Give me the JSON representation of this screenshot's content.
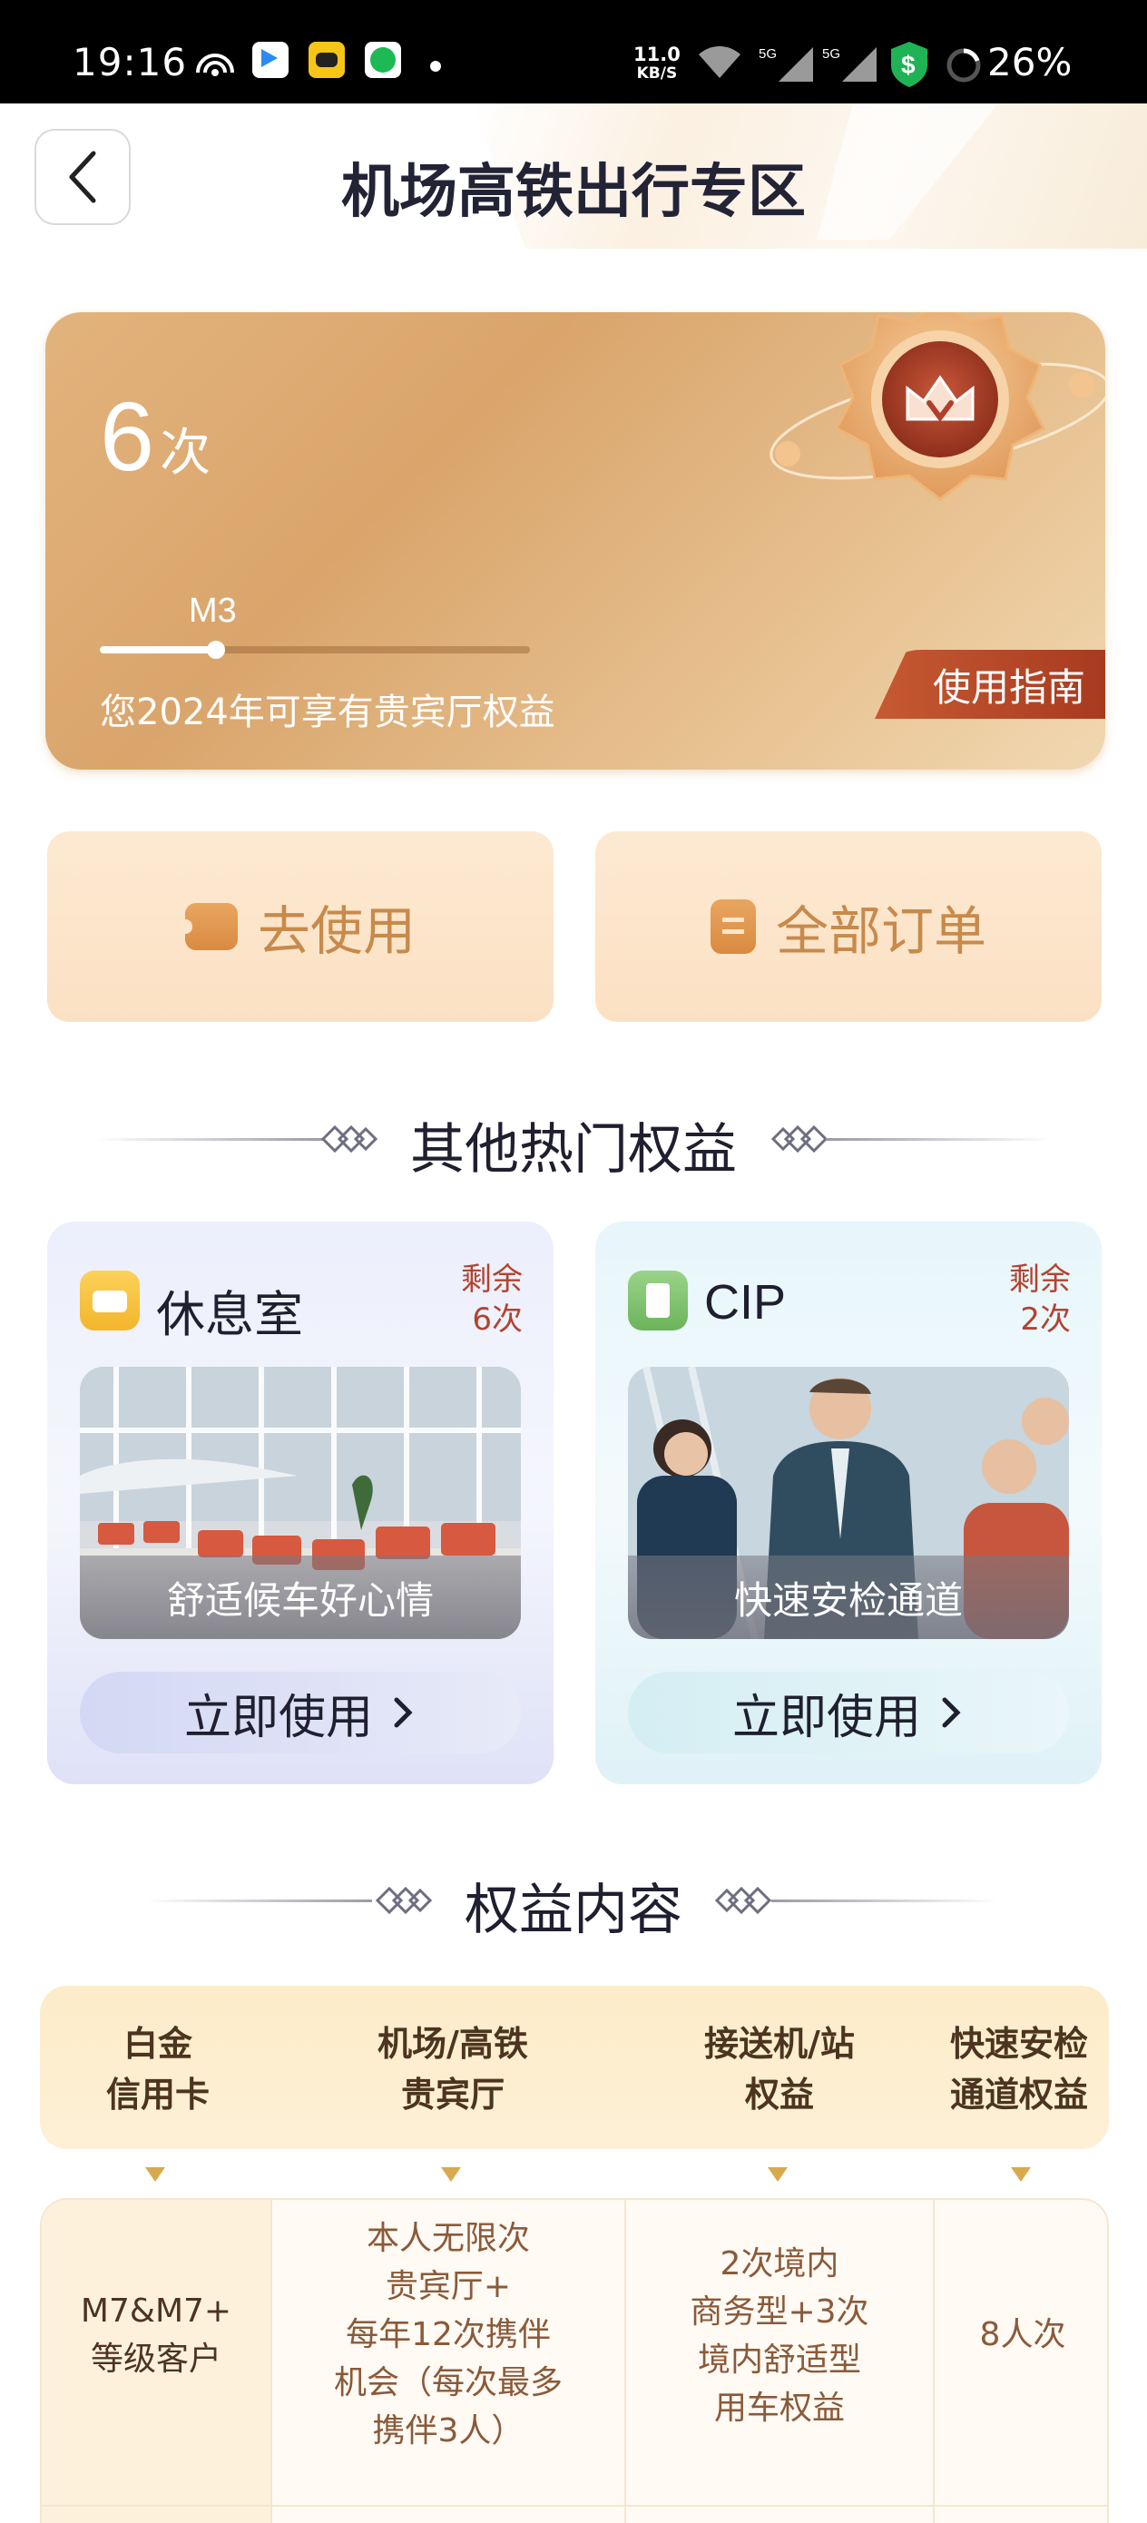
{
  "status_bar": {
    "time": "19:16",
    "net_speed_value": "11.0",
    "net_speed_unit": "KB/S",
    "signal_1": "5G",
    "signal_2": "5G",
    "battery": "26%"
  },
  "header": {
    "title": "机场高铁出行专区"
  },
  "summary_card": {
    "count": "6",
    "count_unit": "次",
    "level": "M3",
    "progress": 0.27,
    "description": "您2024年可享有贵宾厅权益",
    "guide_label": "使用指南"
  },
  "actions": {
    "use_label": "去使用",
    "orders_label": "全部订单"
  },
  "sections": {
    "hot_benefits": "其他热门权益",
    "benefit_content": "权益内容"
  },
  "benefits": [
    {
      "name": "休息室",
      "remain_label": "剩余",
      "remain_count": "6次",
      "caption": "舒适候车好心情",
      "use_label": "立即使用"
    },
    {
      "name": "CIP",
      "remain_label": "剩余",
      "remain_count": "2次",
      "caption": "快速安检通道",
      "use_label": "立即使用"
    }
  ],
  "table": {
    "headers": [
      [
        "白金",
        "信用卡"
      ],
      [
        "机场/高铁",
        "贵宾厅"
      ],
      [
        "接送机/站",
        "权益"
      ],
      [
        "快速安检",
        "通道权益"
      ]
    ],
    "rows": [
      {
        "tier": [
          "M7&M7+",
          "等级客户"
        ],
        "lounge": [
          "本人无限次",
          "贵宾厅+",
          "每年12次携伴",
          "机会（每次最多",
          "携伴3人）"
        ],
        "transfer": [
          "2次境内",
          "商务型+3次",
          "境内舒适型",
          "用车权益"
        ],
        "security": [
          "8人次"
        ]
      }
    ]
  },
  "colors": {
    "gold_card": "#d9a56c",
    "action_bg": "#fbe1c3",
    "action_text": "#c78a4b",
    "remain_text": "#b2432f",
    "guide_btn": "#a83a1f",
    "table_head": "#fdecc9"
  },
  "icons": {
    "back": "chevron-left-icon",
    "use": "ticket-icon",
    "orders": "order-icon",
    "lounge": "sofa-icon",
    "cip": "document-icon",
    "medal": "crown-medal-icon"
  }
}
